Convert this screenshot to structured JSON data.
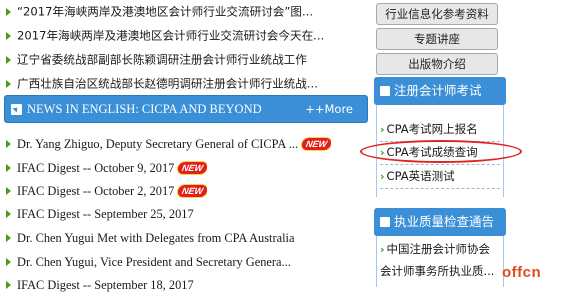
{
  "news": {
    "items": [
      "“2017年海峡两岸及港澳地区会计师行业交流研讨会”图...",
      "2017年海峡两岸及港澳地区会计师行业交流研讨会今天在...",
      "辽宁省委统战部副部长陈颖调研注册会计师行业统战工作",
      "广西壮族自治区统战部长赵德明调研注册会计师行业统战..."
    ]
  },
  "english_section": {
    "title": "NEWS IN ENGLISH: CICPA AND BEYOND",
    "more": "++More",
    "items": [
      {
        "text": "Dr. Yang Zhiguo, Deputy Secretary General of CICPA ...",
        "badge": "NEW"
      },
      {
        "text": "IFAC Digest -- October 9, 2017",
        "badge": "NEW"
      },
      {
        "text": "IFAC Digest -- October 2, 2017",
        "badge": "NEW"
      },
      {
        "text": "IFAC Digest -- September 25, 2017",
        "badge": ""
      },
      {
        "text": "Dr. Chen Yugui Met with Delegates from CPA Australia",
        "badge": ""
      },
      {
        "text": "Dr. Chen Yugui, Vice President and Secretary Genera...",
        "badge": ""
      },
      {
        "text": "IFAC Digest -- September 18, 2017",
        "badge": ""
      }
    ]
  },
  "sidebar": {
    "buttons": [
      "行业信息化参考资料",
      "专题讲座",
      "出版物介绍"
    ],
    "exam_panel": {
      "title": "注册会计师考试",
      "items": [
        "CPA考试网上报名",
        "CPA考试成绩查询",
        "CPA英语测试"
      ]
    },
    "quality_panel": {
      "title": "执业质量检查通告",
      "items": [
        "中国注册会计师协会",
        "会计师事务所执业质..."
      ]
    }
  },
  "watermark": "offcn",
  "colors": {
    "accent": "#3a8fd6",
    "highlight_circle": "#e0241f",
    "bullet": "#4a9a1c"
  }
}
